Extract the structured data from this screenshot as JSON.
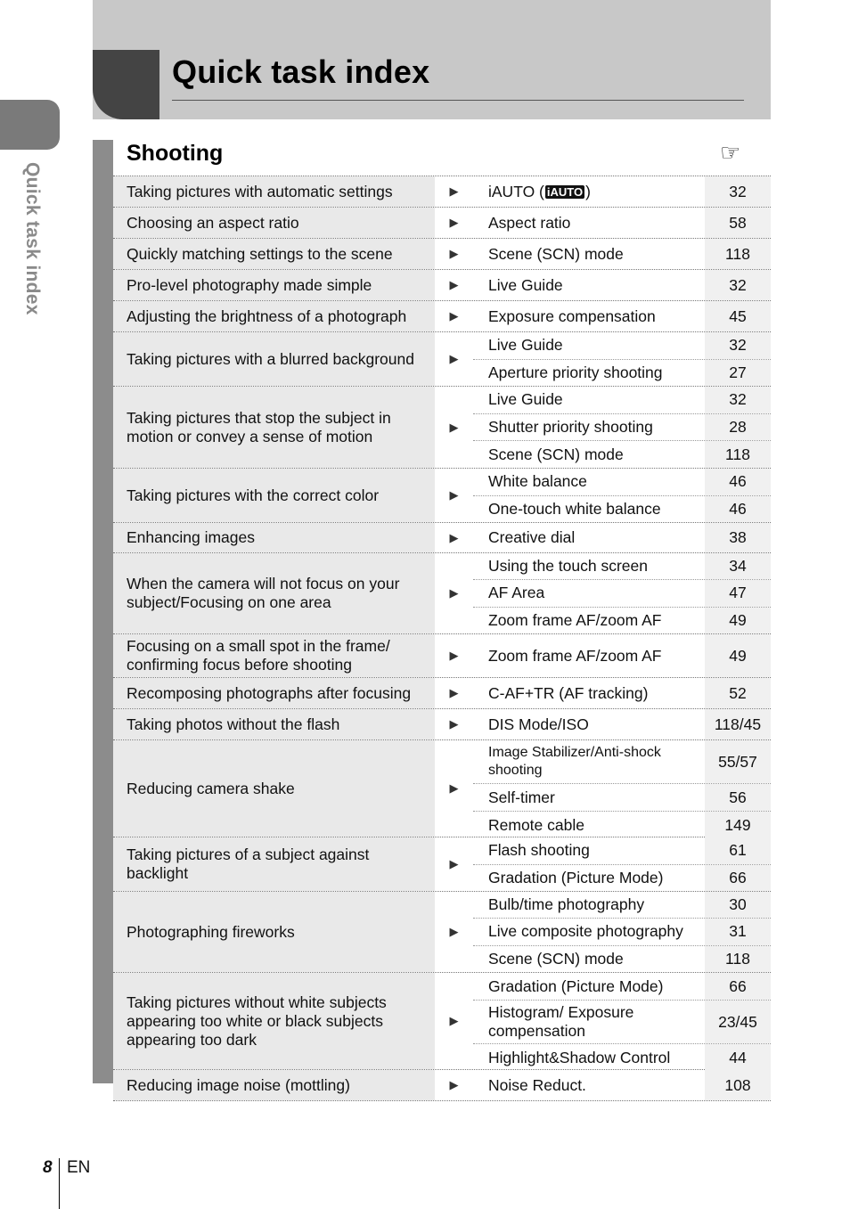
{
  "page": {
    "title": "Quick task index",
    "side_tab_label": "Quick task index",
    "section_title": "Shooting",
    "reference_icon": "☞",
    "footer_page": "8",
    "footer_lang": "EN"
  },
  "rows": [
    {
      "task": "Taking pictures with automatic settings",
      "refs": [
        {
          "label": "iAUTO (",
          "badge": "iAUTO",
          "suffix": ")",
          "page": "32"
        }
      ]
    },
    {
      "task": "Choosing an aspect ratio",
      "refs": [
        {
          "label": "Aspect ratio",
          "page": "58"
        }
      ]
    },
    {
      "task": "Quickly matching settings to the scene",
      "refs": [
        {
          "label": "Scene (SCN) mode",
          "page": "118"
        }
      ]
    },
    {
      "task": "Pro-level photography made simple",
      "refs": [
        {
          "label": "Live Guide",
          "page": "32"
        }
      ]
    },
    {
      "task": "Adjusting the brightness of a photograph",
      "refs": [
        {
          "label": "Exposure compensation",
          "page": "45"
        }
      ]
    },
    {
      "task": "Taking pictures with a blurred background",
      "refs": [
        {
          "label": "Live Guide",
          "page": "32"
        },
        {
          "label": "Aperture priority shooting",
          "page": "27"
        }
      ]
    },
    {
      "task": "Taking pictures that stop the subject in motion or convey a sense of motion",
      "refs": [
        {
          "label": "Live Guide",
          "page": "32"
        },
        {
          "label": "Shutter priority shooting",
          "page": "28"
        },
        {
          "label": "Scene (SCN) mode",
          "page": "118"
        }
      ]
    },
    {
      "task": "Taking pictures with the correct color",
      "refs": [
        {
          "label": "White balance",
          "page": "46"
        },
        {
          "label": "One-touch white balance",
          "page": "46"
        }
      ]
    },
    {
      "task": "Enhancing images",
      "refs": [
        {
          "label": "Creative dial",
          "page": "38"
        }
      ]
    },
    {
      "task": "When the camera will not focus on your subject/Focusing on one area",
      "refs": [
        {
          "label": "Using the touch screen",
          "page": "34"
        },
        {
          "label": "AF Area",
          "page": "47"
        },
        {
          "label": "Zoom frame AF/zoom AF",
          "page": "49"
        }
      ]
    },
    {
      "task": "Focusing on a small spot in the frame/ confirming focus before shooting",
      "refs": [
        {
          "label": "Zoom frame AF/zoom AF",
          "page": "49"
        }
      ]
    },
    {
      "task": "Recomposing photographs after focusing",
      "refs": [
        {
          "label": "C-AF+TR (AF tracking)",
          "page": "52"
        }
      ]
    },
    {
      "task": "Taking photos without the flash",
      "refs": [
        {
          "label": "DIS Mode/ISO",
          "page": "118/45"
        }
      ]
    },
    {
      "task": "Reducing camera shake",
      "refs": [
        {
          "label": "Image Stabilizer/Anti-shock shooting",
          "page": "55/57",
          "small": true
        },
        {
          "label": "Self-timer",
          "page": "56"
        },
        {
          "label": "Remote cable",
          "page": "149"
        }
      ]
    },
    {
      "task": "Taking pictures of a subject against backlight",
      "refs": [
        {
          "label": "Flash shooting",
          "page": "61"
        },
        {
          "label": "Gradation (Picture Mode)",
          "page": "66"
        }
      ]
    },
    {
      "task": "Photographing fireworks",
      "refs": [
        {
          "label": "Bulb/time photography",
          "page": "30"
        },
        {
          "label": "Live composite photography",
          "page": "31"
        },
        {
          "label": "Scene (SCN) mode",
          "page": "118"
        }
      ]
    },
    {
      "task": "Taking pictures without white subjects appearing too white or black subjects appearing too dark",
      "refs": [
        {
          "label": "Gradation (Picture Mode)",
          "page": "66"
        },
        {
          "label": "Histogram/ Exposure compensation",
          "page": "23/45"
        },
        {
          "label": "Highlight&Shadow Control",
          "page": "44"
        }
      ]
    },
    {
      "task": "Reducing image noise (mottling)",
      "refs": [
        {
          "label": "Noise Reduct.",
          "page": "108"
        }
      ]
    }
  ]
}
